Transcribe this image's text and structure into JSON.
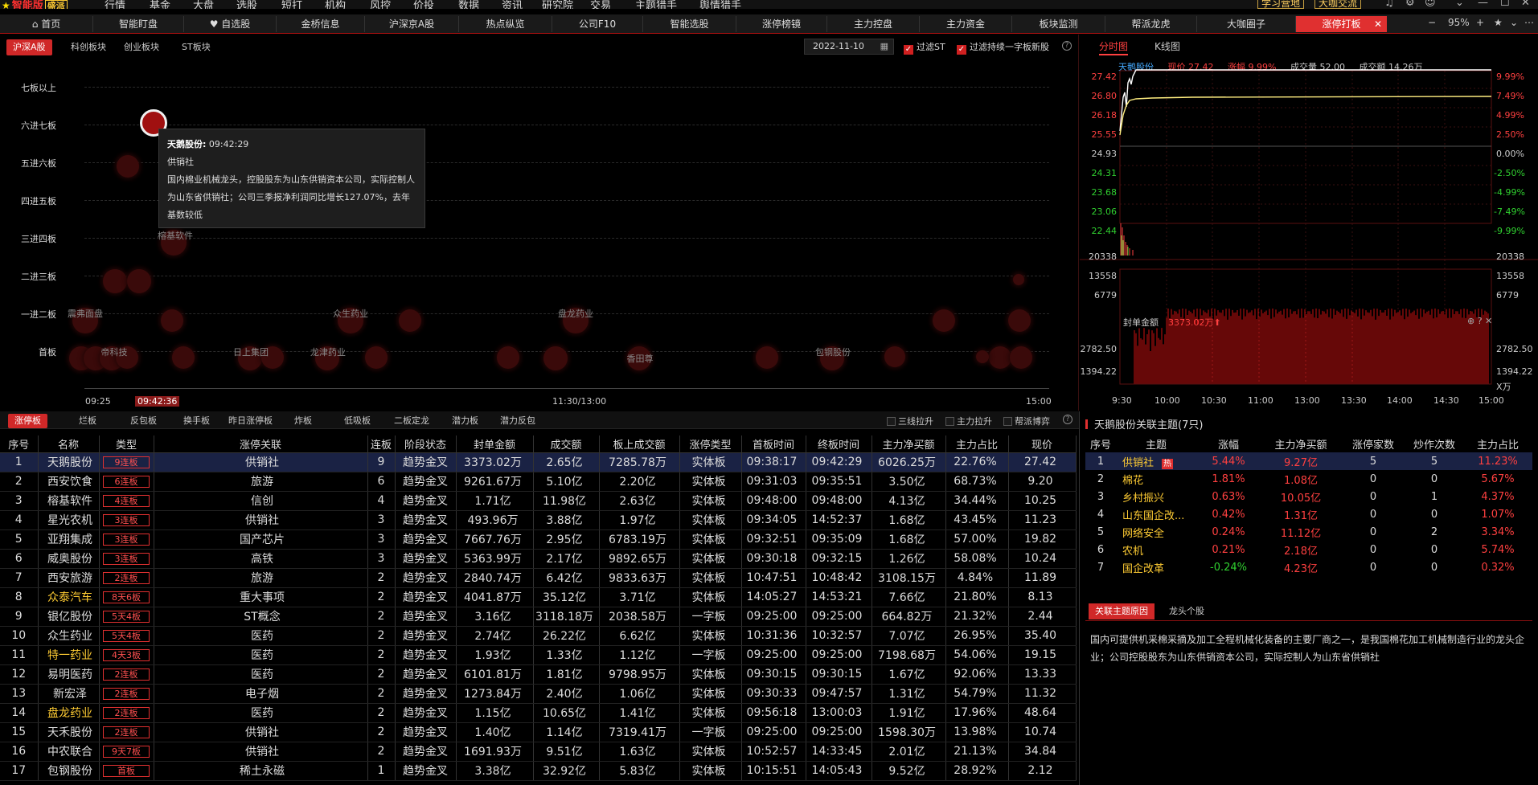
{
  "menubar": {
    "logo": "智能版",
    "edition": "盛派",
    "items": [
      "行情",
      "基金",
      "大盘",
      "选股",
      "短打",
      "机构",
      "风控",
      "价投",
      "数据",
      "资讯",
      "研究院",
      "交易",
      "主题猎手",
      "舆情猎手"
    ],
    "btn_learn": "学习营地",
    "btn_chat": "大咖交流"
  },
  "tabs": [
    "首页",
    "智能盯盘",
    "自选股",
    "金桥信息",
    "沪深京A股",
    "热点纵览",
    "公司F10",
    "智能选股",
    "涨停榜镜",
    "主力控盘",
    "主力资金",
    "板块监测",
    "帮派龙虎",
    "大咖圈子",
    "涨停打板"
  ],
  "zoom": "95%",
  "left": {
    "subtabs": [
      "沪深A股",
      "科创板块",
      "创业板块",
      "ST板块"
    ],
    "date": "2022-11-10",
    "filter_st": "过滤ST",
    "filter_new": "过滤持续一字板新股",
    "boards": [
      "七板以上",
      "六进七板",
      "五进六板",
      "四进五板",
      "三进四板",
      "二进三板",
      "一进二板",
      "首板"
    ],
    "bubble_labels": [
      {
        "text": "榕基软件"
      },
      {
        "text": "众生药业"
      },
      {
        "text": "盘龙药业"
      },
      {
        "text": "震弗面盘"
      },
      {
        "text": "日上集团"
      },
      {
        "text": "龙津药业"
      },
      {
        "text": "包钢股份"
      },
      {
        "text": "香田尊"
      },
      {
        "text": "帝科技"
      }
    ],
    "tooltip": {
      "name": "天鹅股份:",
      "time": "09:42:29",
      "theme": "供销社",
      "desc": "国内棉业机械龙头，控股股东为山东供销资本公司，实际控制人为山东省供销社；公司三季报净利润同比增长127.07%，去年基数较低"
    },
    "times": [
      "09:25",
      "09:42:36",
      "11:30/13:00",
      "15:00"
    ]
  },
  "right": {
    "tabs": [
      "分时图",
      "K线图"
    ],
    "quote": {
      "name": "天鹅股份",
      "price_label": "现价 27.42",
      "chg_label": "涨幅 9.99%",
      "vol_label": "成交量 52.00",
      "amt_label": "成交额 14.26万"
    },
    "price_ticks": [
      "27.42",
      "26.80",
      "26.18",
      "25.55",
      "24.93",
      "24.31",
      "23.68",
      "23.06",
      "22.44"
    ],
    "pct_ticks": [
      "9.99%",
      "7.49%",
      "4.99%",
      "2.50%",
      "0.00%",
      "-2.50%",
      "-4.99%",
      "-7.49%",
      "-9.99%"
    ],
    "vol_ticks": [
      "20338",
      "13558",
      "6779"
    ],
    "seal_label": "封单金额",
    "seal_value": "3373.02万",
    "seal_ticks": [
      "2782.50",
      "1394.22"
    ],
    "seal_unit": "X万",
    "time_ticks": [
      "9:30",
      "10:00",
      "10:30",
      "11:00",
      "13:00",
      "13:30",
      "14:00",
      "14:30",
      "15:00"
    ]
  },
  "bottom": {
    "tabs": [
      "涨停板",
      "烂板",
      "反包板",
      "换手板",
      "昨日涨停板",
      "炸板",
      "低吸板",
      "二板定龙",
      "潜力板",
      "潜力反包"
    ],
    "checks": [
      "三线拉升",
      "主力拉升",
      "帮派博弈"
    ],
    "headers": [
      "序号",
      "名称",
      "类型",
      "涨停关联",
      "连板",
      "阶段状态",
      "封单金额",
      "成交额",
      "板上成交额",
      "涨停类型",
      "首板时间",
      "终板时间",
      "主力净买额",
      "主力占比",
      "现价"
    ],
    "rows": [
      [
        "1",
        "天鹅股份",
        "9连板",
        "供销社",
        "9",
        "趋势金叉",
        "3373.02万",
        "2.65亿",
        "7285.78万",
        "实体板",
        "09:38:17",
        "09:42:29",
        "6026.25万",
        "22.76%",
        "27.42"
      ],
      [
        "2",
        "西安饮食",
        "6连板",
        "旅游",
        "6",
        "趋势金叉",
        "9261.67万",
        "5.10亿",
        "2.20亿",
        "实体板",
        "09:31:03",
        "09:35:51",
        "3.50亿",
        "68.73%",
        "9.20"
      ],
      [
        "3",
        "榕基软件",
        "4连板",
        "信创",
        "4",
        "趋势金叉",
        "1.71亿",
        "11.98亿",
        "2.63亿",
        "实体板",
        "09:48:00",
        "09:48:00",
        "4.13亿",
        "34.44%",
        "10.25"
      ],
      [
        "4",
        "星光农机",
        "3连板",
        "供销社",
        "3",
        "趋势金叉",
        "493.96万",
        "3.88亿",
        "1.97亿",
        "实体板",
        "09:34:05",
        "14:52:37",
        "1.68亿",
        "43.45%",
        "11.23"
      ],
      [
        "5",
        "亚翔集成",
        "3连板",
        "国产芯片",
        "3",
        "趋势金叉",
        "7667.76万",
        "2.95亿",
        "6783.19万",
        "实体板",
        "09:32:51",
        "09:35:09",
        "1.68亿",
        "57.00%",
        "19.82"
      ],
      [
        "6",
        "威奥股份",
        "3连板",
        "高铁",
        "3",
        "趋势金叉",
        "5363.99万",
        "2.17亿",
        "9892.65万",
        "实体板",
        "09:30:18",
        "09:32:15",
        "1.26亿",
        "58.08%",
        "10.24"
      ],
      [
        "7",
        "西安旅游",
        "2连板",
        "旅游",
        "2",
        "趋势金叉",
        "2840.74万",
        "6.42亿",
        "9833.63万",
        "实体板",
        "10:47:51",
        "10:48:42",
        "3108.15万",
        "4.84%",
        "11.89"
      ],
      [
        "8",
        "众泰汽车",
        "8天6板",
        "重大事项",
        "2",
        "趋势金叉",
        "4041.87万",
        "35.12亿",
        "3.71亿",
        "实体板",
        "14:05:27",
        "14:53:21",
        "7.66亿",
        "21.80%",
        "8.13"
      ],
      [
        "9",
        "银亿股份",
        "5天4板",
        "ST概念",
        "2",
        "趋势金叉",
        "3.16亿",
        "3118.18万",
        "2038.58万",
        "一字板",
        "09:25:00",
        "09:25:00",
        "664.82万",
        "21.32%",
        "2.44"
      ],
      [
        "10",
        "众生药业",
        "5天4板",
        "医药",
        "2",
        "趋势金叉",
        "2.74亿",
        "26.22亿",
        "6.62亿",
        "实体板",
        "10:31:36",
        "10:32:57",
        "7.07亿",
        "26.95%",
        "35.40"
      ],
      [
        "11",
        "特一药业",
        "4天3板",
        "医药",
        "2",
        "趋势金叉",
        "1.93亿",
        "1.33亿",
        "1.12亿",
        "一字板",
        "09:25:00",
        "09:25:00",
        "7198.68万",
        "54.06%",
        "19.15"
      ],
      [
        "12",
        "易明医药",
        "2连板",
        "医药",
        "2",
        "趋势金叉",
        "6101.81万",
        "1.81亿",
        "9798.95万",
        "实体板",
        "09:30:15",
        "09:30:15",
        "1.67亿",
        "92.06%",
        "13.33"
      ],
      [
        "13",
        "新宏泽",
        "2连板",
        "电子烟",
        "2",
        "趋势金叉",
        "1273.84万",
        "2.40亿",
        "1.06亿",
        "实体板",
        "09:30:33",
        "09:47:57",
        "1.31亿",
        "54.79%",
        "11.32"
      ],
      [
        "14",
        "盘龙药业",
        "2连板",
        "医药",
        "2",
        "趋势金叉",
        "1.15亿",
        "10.65亿",
        "1.41亿",
        "实体板",
        "09:56:18",
        "13:00:03",
        "1.91亿",
        "17.96%",
        "48.64"
      ],
      [
        "15",
        "天禾股份",
        "2连板",
        "供销社",
        "2",
        "趋势金叉",
        "1.40亿",
        "1.14亿",
        "7319.41万",
        "一字板",
        "09:25:00",
        "09:25:00",
        "1598.30万",
        "13.98%",
        "10.74"
      ],
      [
        "16",
        "中农联合",
        "9天7板",
        "供销社",
        "2",
        "趋势金叉",
        "1691.93万",
        "9.51亿",
        "1.63亿",
        "实体板",
        "10:52:57",
        "14:33:45",
        "2.01亿",
        "21.13%",
        "34.84"
      ],
      [
        "17",
        "包钢股份",
        "首板",
        "稀土永磁",
        "1",
        "趋势金叉",
        "3.38亿",
        "32.92亿",
        "5.83亿",
        "实体板",
        "10:15:51",
        "14:05:43",
        "9.52亿",
        "28.92%",
        "2.12"
      ]
    ]
  },
  "theme_panel": {
    "title": "天鹅股份关联主题(7只)",
    "headers": [
      "序号",
      "主题",
      "涨幅",
      "主力净买额",
      "涨停家数",
      "炒作次数",
      "主力占比"
    ],
    "hot": "热",
    "rows": [
      [
        "1",
        "供销社",
        "5.44%",
        "9.27亿",
        "5",
        "5",
        "11.23%"
      ],
      [
        "2",
        "棉花",
        "1.81%",
        "1.08亿",
        "0",
        "0",
        "5.67%"
      ],
      [
        "3",
        "乡村振兴",
        "0.63%",
        "10.05亿",
        "0",
        "1",
        "4.37%"
      ],
      [
        "4",
        "山东国企改...",
        "0.42%",
        "1.31亿",
        "0",
        "0",
        "1.07%"
      ],
      [
        "5",
        "网络安全",
        "0.24%",
        "11.12亿",
        "0",
        "2",
        "3.34%"
      ],
      [
        "6",
        "农机",
        "0.21%",
        "2.18亿",
        "0",
        "0",
        "5.74%"
      ],
      [
        "7",
        "国企改革",
        "-0.24%",
        "4.23亿",
        "0",
        "0",
        "0.32%"
      ]
    ],
    "subtabs": [
      "关联主题原因",
      "龙头个股"
    ],
    "reason": "国内可提供机采棉采摘及加工全程机械化装备的主要厂商之一，是我国棉花加工机械制造行业的龙头企业；公司控股股东为山东供销资本公司，实际控制人为山东省供销社"
  },
  "colors": {
    "accent": "#d02828",
    "up": "#ff4040",
    "down": "#30d030",
    "name": "#44aaff"
  }
}
